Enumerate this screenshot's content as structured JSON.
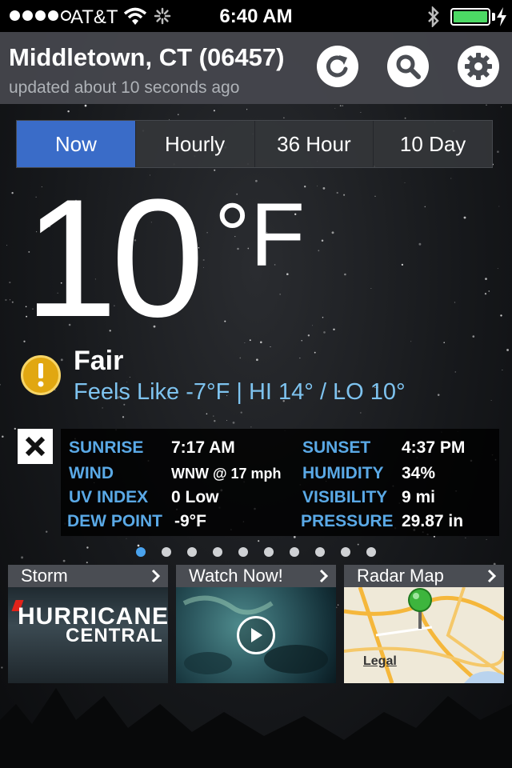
{
  "status_bar": {
    "carrier": "AT&T",
    "time": "6:40 AM",
    "signal_bars": 4,
    "signal_max": 5,
    "battery_level": 1.0,
    "battery_color": "#4cd964"
  },
  "header": {
    "location": "Middletown, CT (06457)",
    "updated": "updated about 10 seconds ago",
    "icons": [
      "refresh-icon",
      "search-icon",
      "gear-icon"
    ]
  },
  "tabs": [
    {
      "label": "Now",
      "active": true
    },
    {
      "label": "Hourly",
      "active": false
    },
    {
      "label": "36 Hour",
      "active": false
    },
    {
      "label": "10 Day",
      "active": false
    }
  ],
  "current": {
    "temperature": "10",
    "unit": "°F",
    "condition": "Fair",
    "feels_like": "Feels Like -7°F | HI 14° / LO 10°",
    "alert_icon": "exclamation-icon",
    "alert_color": "#e1a711"
  },
  "details": {
    "sunrise_label": "SUNRISE",
    "sunrise": "7:17 AM",
    "sunset_label": "SUNSET",
    "sunset": "4:37 PM",
    "wind_label": "WIND",
    "wind": "WNW @ 17 mph",
    "humidity_label": "HUMIDITY",
    "humidity": "34%",
    "uv_label": "UV INDEX",
    "uv": "0 Low",
    "visibility_label": "VISIBILITY",
    "visibility": "9 mi",
    "dew_label": "DEW POINT",
    "dew": "-9°F",
    "pressure_label": "PRESSURE",
    "pressure": "29.87 in"
  },
  "pager": {
    "count": 10,
    "active_index": 0,
    "active_color": "#4aa3ee"
  },
  "cards": {
    "storm": {
      "title": "Storm",
      "brand_line1": "HURRICANE",
      "brand_line2": "CENTRAL"
    },
    "watch": {
      "title": "Watch Now!"
    },
    "radar": {
      "title": "Radar Map",
      "legal": "Legal"
    }
  },
  "colors": {
    "accent_blue": "#3a6cc8",
    "label_blue": "#5aa9e6",
    "feels_blue": "#7ec3ef"
  }
}
